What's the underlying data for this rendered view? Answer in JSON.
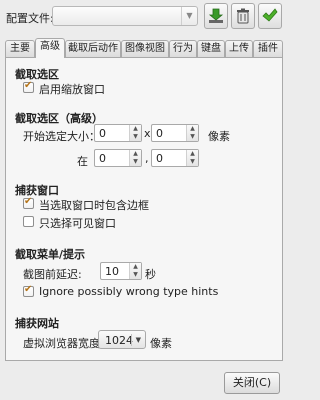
{
  "profile": {
    "label": "配置文件:",
    "value": ""
  },
  "toolbar": [
    {
      "name": "download-icon",
      "color": "#3a9a2a"
    },
    {
      "name": "trash-icon",
      "color": "#555555"
    },
    {
      "name": "check-icon",
      "color": "#4caf2a"
    }
  ],
  "tabs": [
    "主要",
    "高级",
    "截取后动作",
    "图像视图",
    "行为",
    "键盘",
    "上传",
    "插件"
  ],
  "active_tab": 1,
  "capture_region": {
    "title": "截取选区",
    "zoom_window": {
      "label": "启用缩放窗口",
      "checked": true
    }
  },
  "capture_region_advanced": {
    "title": "截取选区（高级）",
    "initial_size_label": "开始选定大小：",
    "width": "0",
    "height": "0",
    "x_sep": "x",
    "unit": "像素",
    "at_label": "在",
    "pos_x": "0",
    "pos_y": "0",
    "comma": ","
  },
  "capture_window": {
    "title": "捕获窗口",
    "include_border": {
      "label": "当选取窗口时包含边框",
      "checked": true
    },
    "visible_only": {
      "label": "只选择可见窗口",
      "checked": false
    }
  },
  "capture_menu": {
    "title": "截取菜单/提示",
    "delay_label": "截图前延迟:",
    "delay_value": "10",
    "delay_unit": "秒",
    "ignore_hints": {
      "label": "Ignore possibly wrong type hints",
      "checked": true
    }
  },
  "capture_web": {
    "title": "捕获网站",
    "browser_width_label": "虚拟浏览器宽度:",
    "browser_width_value": "1024",
    "unit": "像素"
  },
  "close_button": "关闭(C)"
}
